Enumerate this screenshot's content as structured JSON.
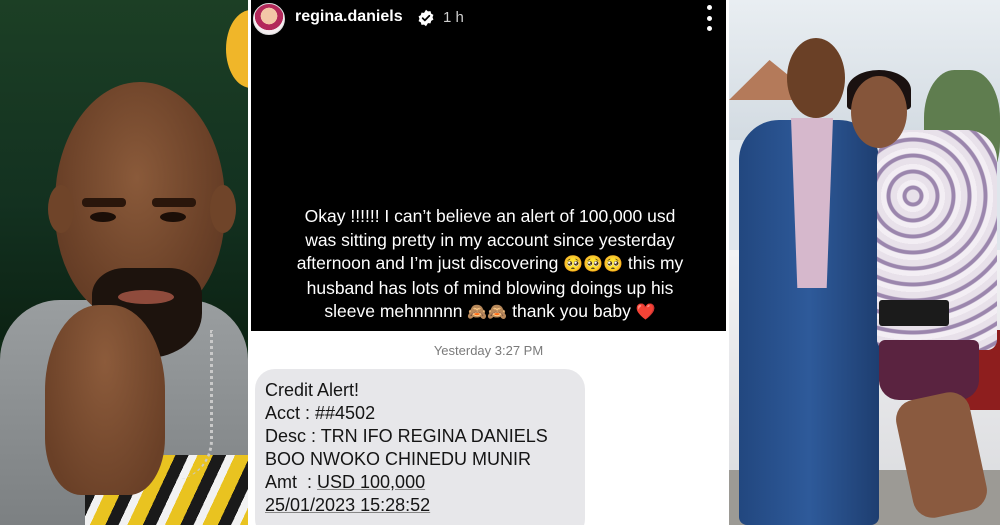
{
  "story": {
    "username": "regina.daniels",
    "time_ago": "1 h",
    "caption": {
      "line1": "Okay !!!!!! I can’t believe an alert of 100,000 usd",
      "line2": "was sitting pretty in my account since yesterday",
      "line3": "afternoon and I’m just discovering",
      "line3_emoji": "🥺🥺🥺",
      "line3_tail": "this my",
      "line4": "husband has lots of mind blowing doings up his",
      "line5": "sleeve mehnnnnn",
      "line5_emoji": "🙈🙈",
      "line5_tail": "thank you baby",
      "line5_heart": "❤️"
    }
  },
  "sms": {
    "timestamp": "Yesterday 3:27 PM",
    "title": "Credit Alert!",
    "acct": "Acct : ##4502",
    "desc1": "Desc : TRN IFO REGINA DANIELS",
    "desc2": "BOO NWOKO CHINEDU MUNIR",
    "amt_label": "Amt  : ",
    "amt_value": "USD 100,000",
    "date": "25/01/2023 15:28:52"
  },
  "icons": {
    "verified": "verified-badge-icon",
    "more": "more-vertical-icon"
  },
  "colors": {
    "story_bg": "#000000",
    "sms_bubble": "#e7e7ea",
    "heart": "#e0203a"
  }
}
